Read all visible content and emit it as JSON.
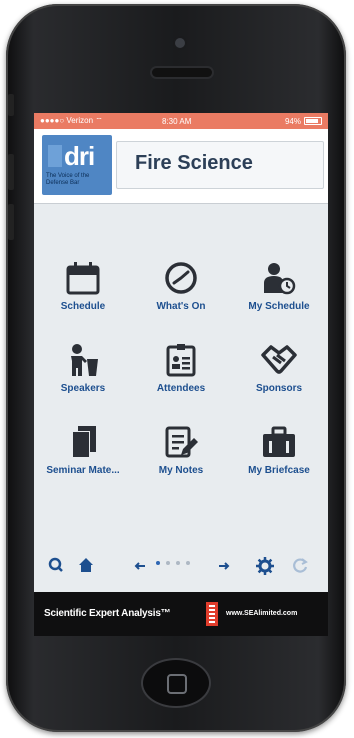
{
  "status_bar": {
    "carrier": "●●●●○ Verizon ⌔",
    "time": "8:30 AM",
    "battery": "94%"
  },
  "header": {
    "logo_text": "dri",
    "logo_tagline": "The Voice of the Defense Bar",
    "title": "Fire Science"
  },
  "menu": [
    {
      "label": "Schedule",
      "icon": "calendar-icon"
    },
    {
      "label": "What's On",
      "icon": "clock-icon"
    },
    {
      "label": "My Schedule",
      "icon": "person-clock-icon"
    },
    {
      "label": "Speakers",
      "icon": "speaker-podium-icon"
    },
    {
      "label": "Attendees",
      "icon": "badge-icon"
    },
    {
      "label": "Sponsors",
      "icon": "handshake-icon"
    },
    {
      "label": "Seminar Mate...",
      "icon": "documents-icon"
    },
    {
      "label": "My Notes",
      "icon": "notes-edit-icon"
    },
    {
      "label": "My Briefcase",
      "icon": "briefcase-icon"
    }
  ],
  "bottom_nav": {
    "items": [
      "search-icon",
      "home-icon",
      "arrow-left-icon",
      "arrow-right-icon",
      "gear-icon",
      "refresh-icon"
    ],
    "page_count": 4,
    "active_page": 0
  },
  "footer": {
    "brand": "Scientific Expert Analysis™",
    "url": "www.SEAlimited.com"
  },
  "colors": {
    "status_bar": "#ea7b63",
    "accent": "#1d4f8f",
    "icon": "#2b2f36",
    "logo_bg": "#4f86c4"
  }
}
